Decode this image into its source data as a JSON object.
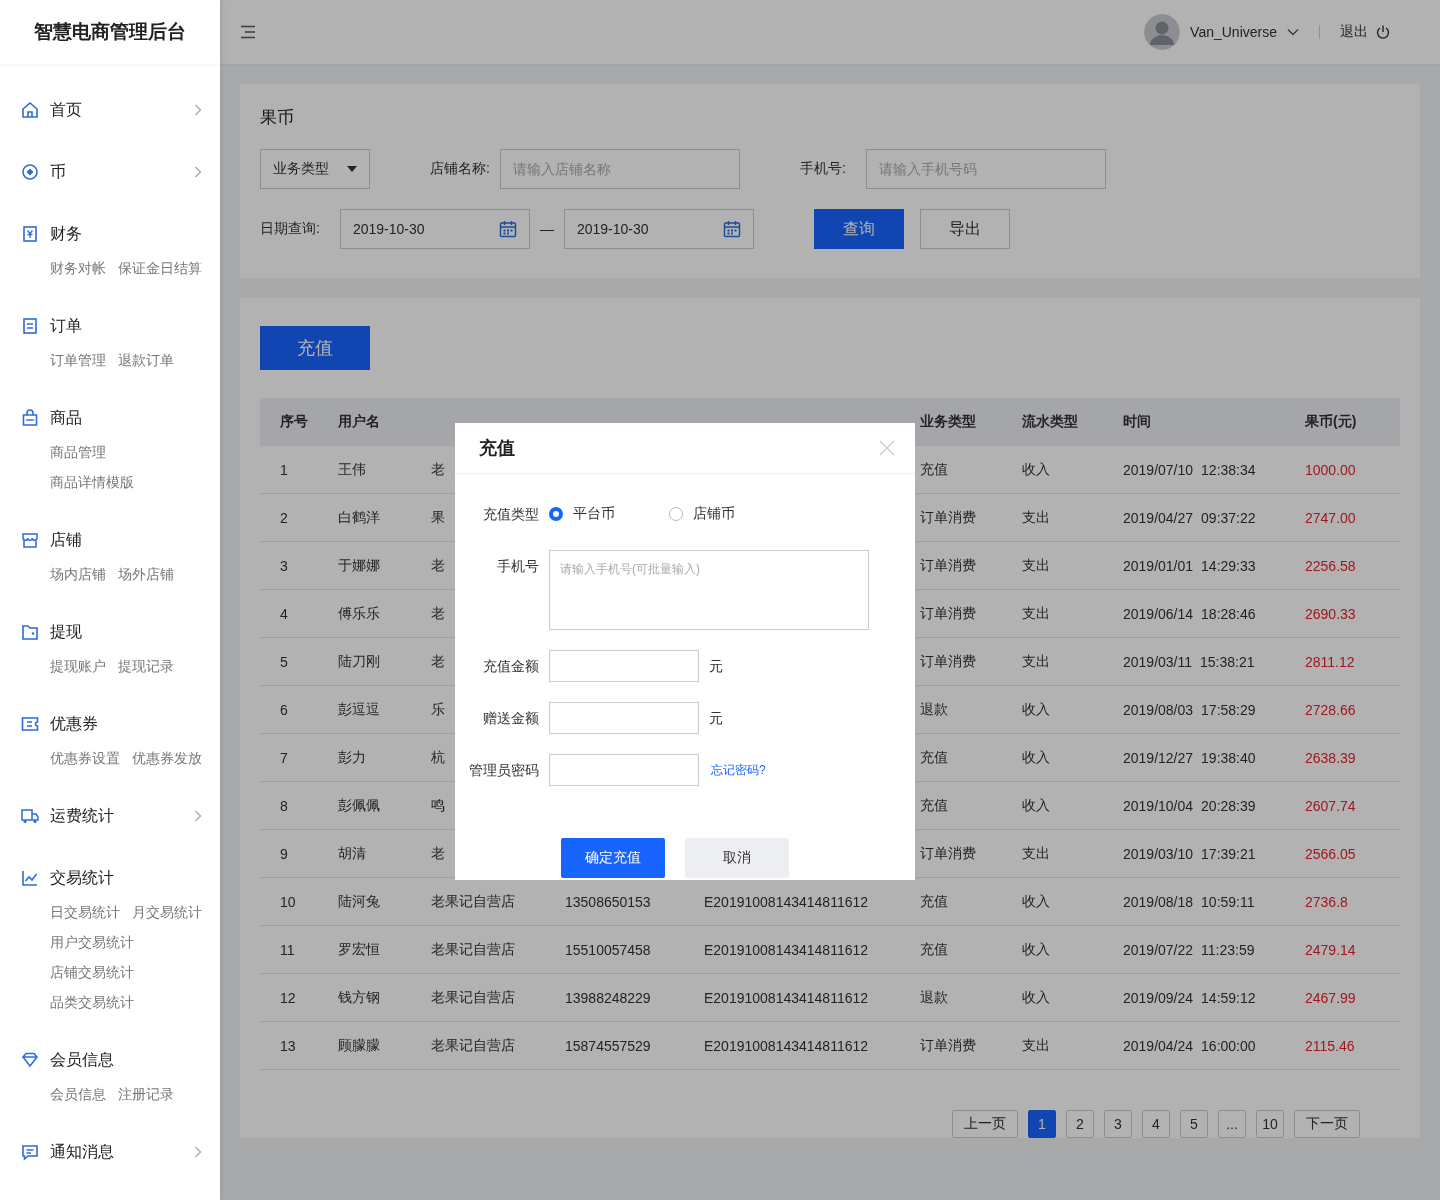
{
  "app_title": "智慧电商管理后台",
  "sidebar": {
    "items": [
      {
        "label": "首页",
        "expandable": true
      },
      {
        "label": "币",
        "expandable": true
      },
      {
        "label": "财务",
        "expandable": false,
        "sub_rows": [
          {
            "children": [
              {
                "label": "财务对帐"
              },
              {
                "label": "保证金日结算"
              }
            ]
          }
        ]
      },
      {
        "label": "订单",
        "expandable": false,
        "sub_rows": [
          {
            "children": [
              {
                "label": "订单管理"
              },
              {
                "label": "退款订单"
              }
            ]
          }
        ]
      },
      {
        "label": "商品",
        "expandable": false,
        "sub_rows": [
          {
            "children": [
              {
                "label": "商品管理"
              }
            ]
          },
          {
            "children": [
              {
                "label": "商品详情模版"
              }
            ]
          }
        ]
      },
      {
        "label": "店铺",
        "expandable": false,
        "sub_rows": [
          {
            "children": [
              {
                "label": "场内店铺"
              },
              {
                "label": "场外店铺"
              }
            ]
          }
        ]
      },
      {
        "label": "提现",
        "expandable": false,
        "sub_rows": [
          {
            "children": [
              {
                "label": "提现账户"
              },
              {
                "label": "提现记录"
              }
            ]
          }
        ]
      },
      {
        "label": "优惠券",
        "expandable": false,
        "sub_rows": [
          {
            "children": [
              {
                "label": "优惠券设置"
              },
              {
                "label": "优惠券发放"
              }
            ]
          }
        ]
      },
      {
        "label": "运费统计",
        "expandable": true
      },
      {
        "label": "交易统计",
        "expandable": false,
        "sub_rows": [
          {
            "children": [
              {
                "label": "日交易统计"
              },
              {
                "label": "月交易统计"
              }
            ]
          },
          {
            "children": [
              {
                "label": "用户交易统计"
              }
            ]
          },
          {
            "children": [
              {
                "label": "店铺交易统计"
              }
            ]
          },
          {
            "children": [
              {
                "label": "品类交易统计"
              }
            ]
          }
        ]
      },
      {
        "label": "会员信息",
        "expandable": false,
        "sub_rows": [
          {
            "children": [
              {
                "label": "会员信息"
              },
              {
                "label": "注册记录"
              }
            ]
          }
        ]
      },
      {
        "label": "通知消息",
        "expandable": true
      }
    ]
  },
  "topbar": {
    "username": "Van_Universe",
    "logout": "退出"
  },
  "filter": {
    "title": "果币",
    "type_select": "业务类型",
    "store_label": "店铺名称:",
    "store_placeholder": "请输入店铺名称",
    "phone_label": "手机号:",
    "phone_placeholder": "请输入手机号码",
    "date_label": "日期查询:",
    "date_from": "2019-10-30",
    "date_sep": "—",
    "date_to": "2019-10-30",
    "query": "查询",
    "export": "导出"
  },
  "recharge_button": "充值",
  "table": {
    "columns_left": [
      "序号",
      "用户名"
    ],
    "columns_right": [
      "业务类型",
      "流水类型",
      "时间",
      "果币(元)"
    ],
    "rows": [
      {
        "no": "1",
        "user": "王伟",
        "store": "老",
        "biz": "充值",
        "flow": "收入",
        "date": "2019/07/10",
        "time": "12:38:34",
        "amount": "1000.00"
      },
      {
        "no": "2",
        "user": "白鹤洋",
        "store": "果",
        "biz": "订单消费",
        "flow": "支出",
        "date": "2019/04/27",
        "time": "09:37:22",
        "amount": "2747.00"
      },
      {
        "no": "3",
        "user": "于娜娜",
        "store": "老",
        "biz": "订单消费",
        "flow": "支出",
        "date": "2019/01/01",
        "time": "14:29:33",
        "amount": "2256.58"
      },
      {
        "no": "4",
        "user": "傅乐乐",
        "store": "老",
        "biz": "订单消费",
        "flow": "支出",
        "date": "2019/06/14",
        "time": "18:28:46",
        "amount": "2690.33"
      },
      {
        "no": "5",
        "user": "陆刀刚",
        "store": "老",
        "biz": "订单消费",
        "flow": "支出",
        "date": "2019/03/11",
        "time": "15:38:21",
        "amount": "2811.12"
      },
      {
        "no": "6",
        "user": "彭逗逗",
        "store": "乐",
        "biz": "退款",
        "flow": "收入",
        "date": "2019/08/03",
        "time": "17:58:29",
        "amount": "2728.66"
      },
      {
        "no": "7",
        "user": "彭力",
        "store": "杭",
        "biz": "充值",
        "flow": "收入",
        "date": "2019/12/27",
        "time": "19:38:40",
        "amount": "2638.39"
      },
      {
        "no": "8",
        "user": "彭佩佩",
        "store": "鸣",
        "biz": "充值",
        "flow": "收入",
        "date": "2019/10/04",
        "time": "20:28:39",
        "amount": "2607.74"
      },
      {
        "no": "9",
        "user": "胡清",
        "store": "老",
        "biz": "订单消费",
        "flow": "支出",
        "date": "2019/03/10",
        "time": "17:39:21",
        "amount": "2566.05"
      },
      {
        "no": "10",
        "user": "陆河兔",
        "store": "老果记自营店",
        "phone": "13508650153",
        "doc": "E20191008143414811612",
        "biz": "充值",
        "flow": "收入",
        "date": "2019/08/18",
        "time": "10:59:11",
        "amount": "2736.8"
      },
      {
        "no": "11",
        "user": "罗宏恒",
        "store": "老果记自营店",
        "phone": "15510057458",
        "doc": "E20191008143414811612",
        "biz": "充值",
        "flow": "收入",
        "date": "2019/07/22",
        "time": "11:23:59",
        "amount": "2479.14"
      },
      {
        "no": "12",
        "user": "钱方钢",
        "store": "老果记自营店",
        "phone": "13988248229",
        "doc": "E20191008143414811612",
        "biz": "退款",
        "flow": "收入",
        "date": "2019/09/24",
        "time": "14:59:12",
        "amount": "2467.99"
      },
      {
        "no": "13",
        "user": "顾朦朦",
        "store": "老果记自营店",
        "phone": "15874557529",
        "doc": "E20191008143414811612",
        "biz": "订单消费",
        "flow": "支出",
        "date": "2019/04/24",
        "time": "16:00:00",
        "amount": "2115.46"
      }
    ]
  },
  "pagination": {
    "prev": "上一页",
    "next": "下一页",
    "pages": [
      {
        "label": "1",
        "selected": true
      },
      {
        "label": "2",
        "selected": false
      },
      {
        "label": "3",
        "selected": false
      },
      {
        "label": "4",
        "selected": false
      },
      {
        "label": "5",
        "selected": false
      },
      {
        "label": "...",
        "selected": false
      },
      {
        "label": "10",
        "selected": false
      }
    ]
  },
  "dialog": {
    "title": "充值",
    "rows": [
      {
        "kind": "radio",
        "label": "充值类型",
        "options": [
          {
            "label": "平台币",
            "selected": true
          },
          {
            "label": "店铺币",
            "selected": false
          }
        ]
      },
      {
        "kind": "textarea",
        "label": "手机号",
        "placeholder": "请输入手机号(可批量输入)"
      },
      {
        "kind": "input",
        "label": "充值金额",
        "unit": "元"
      },
      {
        "kind": "input",
        "label": "赠送金额",
        "unit": "元"
      },
      {
        "kind": "input",
        "label": "管理员密码",
        "link": "忘记密码?"
      }
    ],
    "confirm": "确定充值",
    "cancel": "取消"
  }
}
